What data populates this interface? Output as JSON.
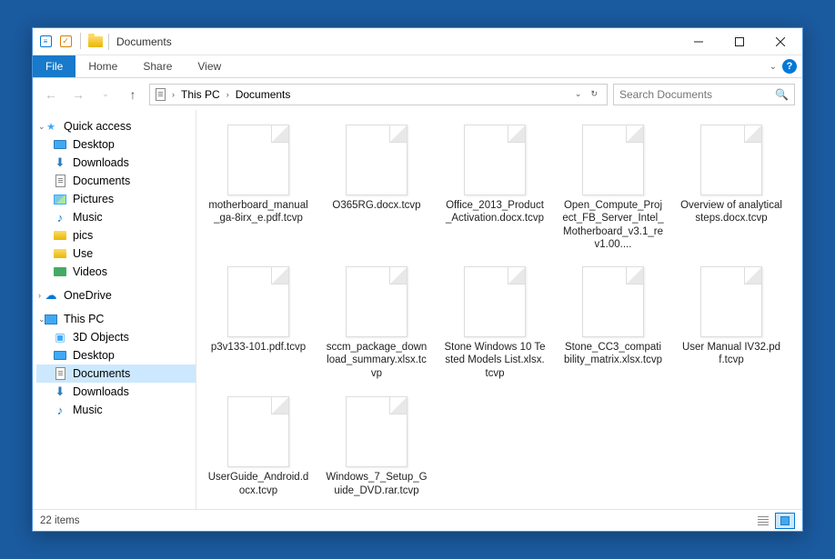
{
  "titlebar": {
    "title": "Documents"
  },
  "ribbon": {
    "file": "File",
    "tabs": [
      "Home",
      "Share",
      "View"
    ]
  },
  "address": {
    "segments": [
      "This PC",
      "Documents"
    ]
  },
  "search": {
    "placeholder": "Search Documents"
  },
  "nav": {
    "quick_access": {
      "label": "Quick access",
      "items": [
        "Desktop",
        "Downloads",
        "Documents",
        "Pictures",
        "Music",
        "pics",
        "Use",
        "Videos"
      ]
    },
    "onedrive": {
      "label": "OneDrive"
    },
    "this_pc": {
      "label": "This PC",
      "items": [
        "3D Objects",
        "Desktop",
        "Documents",
        "Downloads",
        "Music"
      ]
    },
    "selected": "Documents"
  },
  "files": [
    "motherboard_manual_ga-8irx_e.pdf.tcvp",
    "O365RG.docx.tcvp",
    "Office_2013_Product_Activation.docx.tcvp",
    "Open_Compute_Project_FB_Server_Intel_Motherboard_v3.1_rev1.00....",
    "Overview of analytical steps.docx.tcvp",
    "p3v133-101.pdf.tcvp",
    "sccm_package_download_summary.xlsx.tcvp",
    "Stone Windows 10 Tested Models List.xlsx.tcvp",
    "Stone_CC3_compatibility_matrix.xlsx.tcvp",
    "User Manual IV32.pdf.tcvp",
    "UserGuide_Android.docx.tcvp",
    "Windows_7_Setup_Guide_DVD.rar.tcvp"
  ],
  "status": {
    "count": "22 items"
  }
}
